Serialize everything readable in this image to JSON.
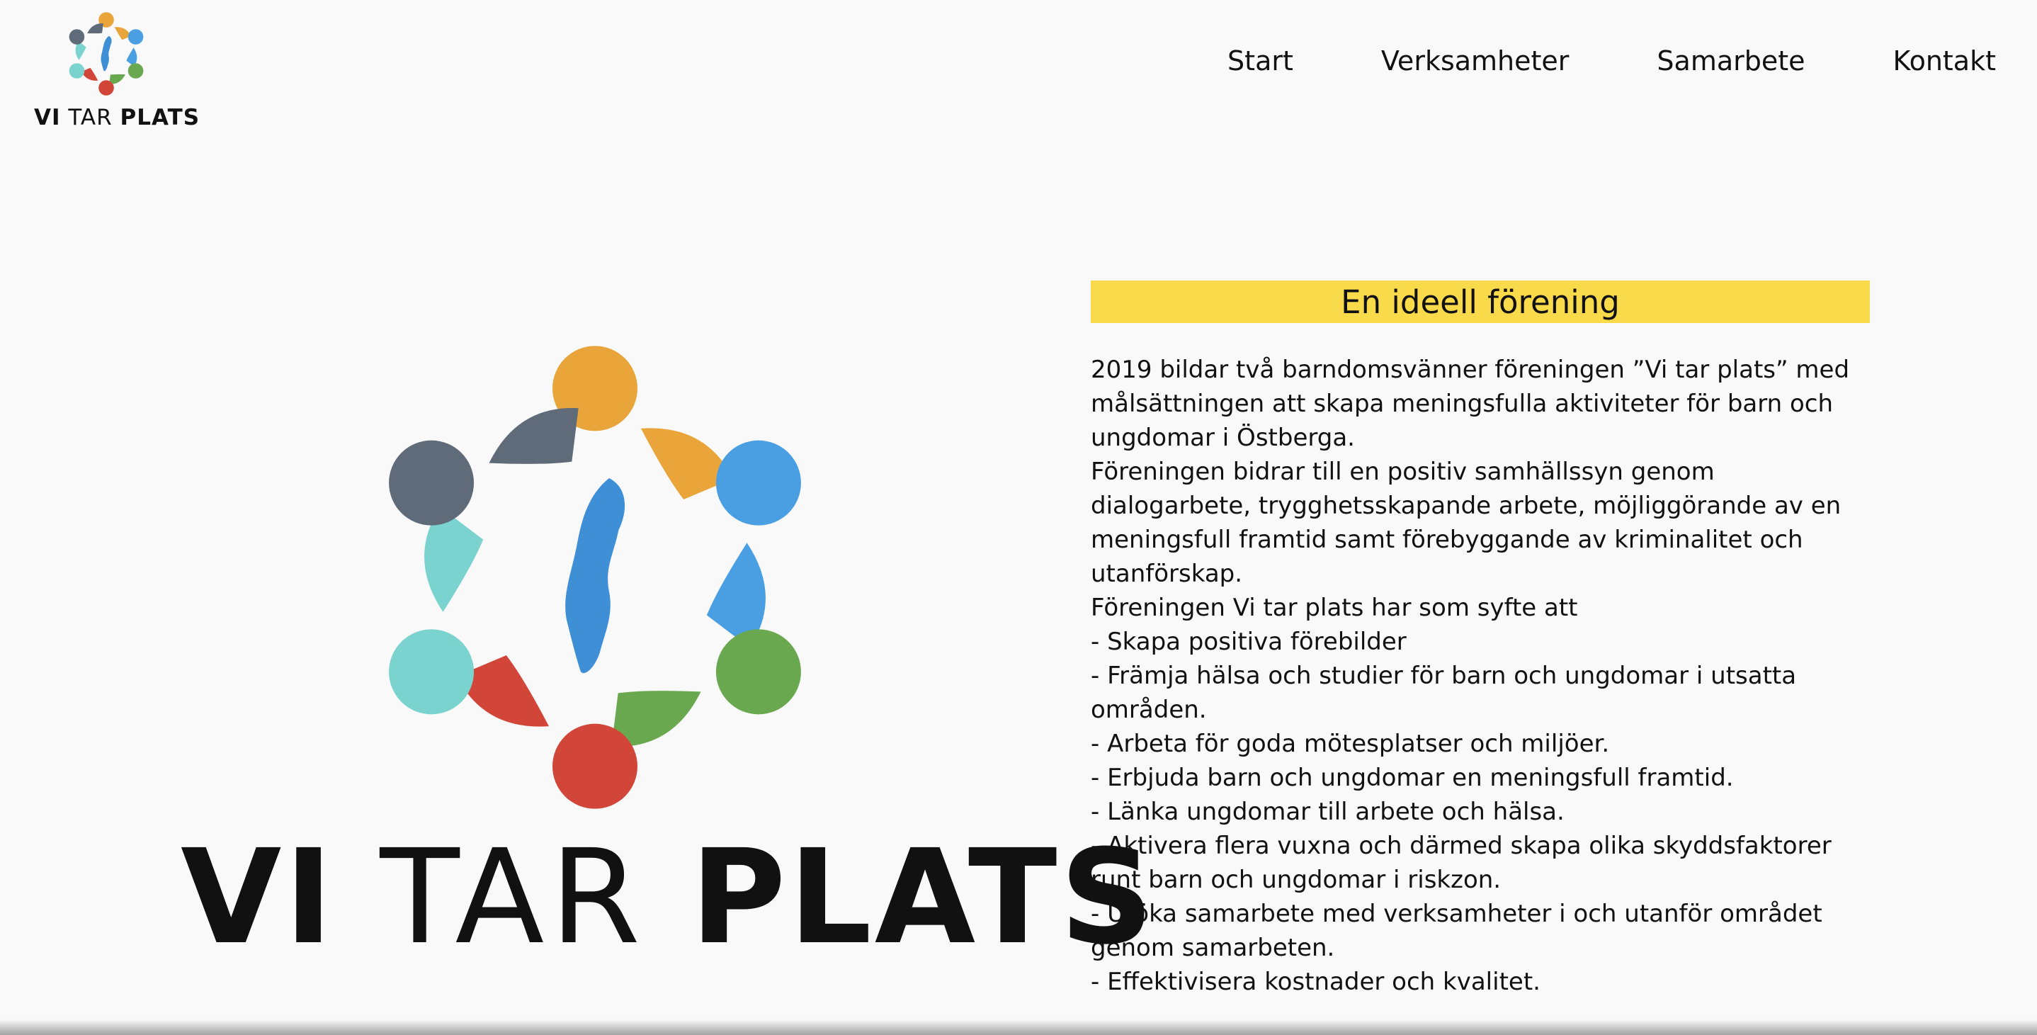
{
  "header": {
    "logo_text": {
      "vi": "VI",
      "tar": "TAR",
      "plats": "PLATS"
    },
    "nav": [
      "Start",
      "Verksamheter",
      "Samarbete",
      "Kontakt"
    ]
  },
  "hero": {
    "logo_text": {
      "vi": "VI",
      "tar": "TAR",
      "plats": "PLATS"
    },
    "emblem_colors": [
      "#e9a53a",
      "#4a9fe2",
      "#6aa84f",
      "#d2463a",
      "#7ad3cf",
      "#5f6b78"
    ],
    "map_color": "#3e8fd6"
  },
  "content": {
    "banner": "En ideell förening",
    "banner_color": "#f9da4b",
    "lines": [
      "2019 bildar två barndomsvänner föreningen ”Vi tar plats” med",
      "målsättningen att skapa meningsfulla aktiviteter för barn och",
      "ungdomar i Östberga.",
      "Föreningen bidrar till en positiv samhällssyn genom",
      "dialogarbete, trygghetsskapande arbete, möjliggörande av en",
      "meningsfull framtid samt förebyggande av kriminalitet och",
      "utanförskap.",
      "Föreningen Vi tar plats har som syfte att",
      "- Skapa positiva förebilder",
      "- Främja hälsa och studier för barn och ungdomar i utsatta",
      "områden.",
      "- Arbeta för goda mötesplatser och miljöer.",
      "- Erbjuda barn och ungdomar en meningsfull framtid.",
      "- Länka ungdomar till arbete och hälsa.",
      "- Aktivera flera vuxna och därmed skapa olika skyddsfaktorer",
      "runt barn och ungdomar i riskzon.",
      "- Utöka samarbete med verksamheter i och utanför området",
      "genom samarbeten.",
      "- Effektivisera kostnader och kvalitet."
    ]
  }
}
